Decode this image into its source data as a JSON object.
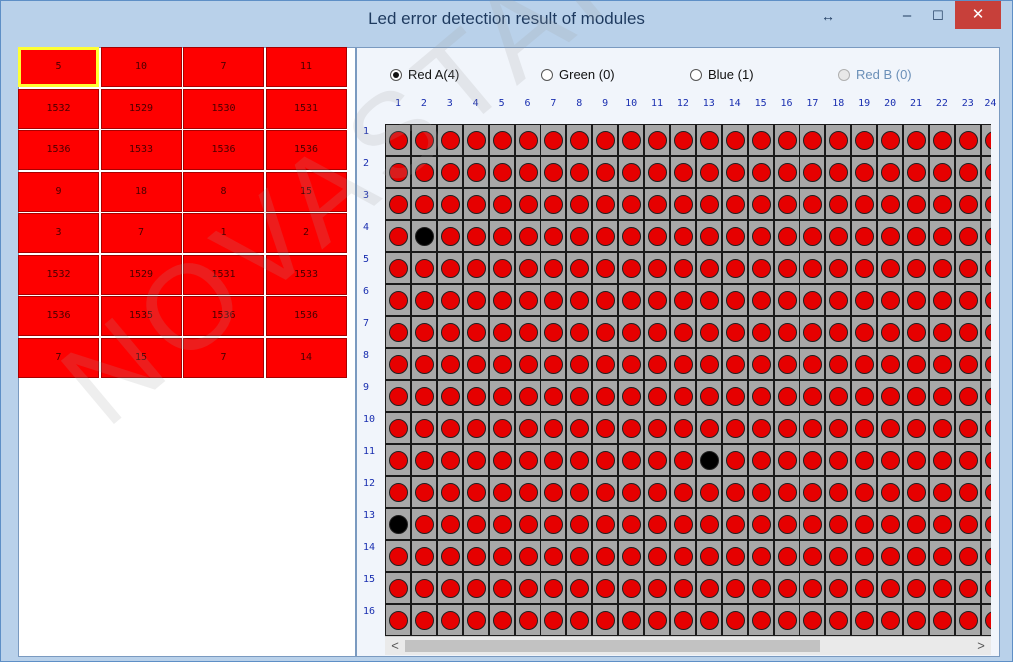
{
  "window": {
    "title": "Led error detection result of modules",
    "controls": {
      "resize": "↔",
      "minimize": "–",
      "maximize": "☐",
      "close": "✕"
    }
  },
  "modules": {
    "selected_index": 0,
    "cells": [
      "5",
      "10",
      "7",
      "11",
      "1532",
      "1529",
      "1530",
      "1531",
      "1536",
      "1533",
      "1536",
      "1536",
      "9",
      "18",
      "8",
      "15",
      "3",
      "7",
      "1",
      "2",
      "1532",
      "1529",
      "1531",
      "1533",
      "1536",
      "1535",
      "1536",
      "1536",
      "7",
      "15",
      "7",
      "14"
    ]
  },
  "color_options": [
    {
      "label": "Red A(4)",
      "checked": true,
      "disabled": false
    },
    {
      "label": "Green (0)",
      "checked": false,
      "disabled": false
    },
    {
      "label": "Blue (1)",
      "checked": false,
      "disabled": false
    },
    {
      "label": "Red B (0)",
      "checked": false,
      "disabled": true
    }
  ],
  "led_matrix": {
    "col_labels": [
      "1",
      "2",
      "3",
      "4",
      "5",
      "6",
      "7",
      "8",
      "9",
      "10",
      "11",
      "12",
      "13",
      "14",
      "15",
      "16",
      "17",
      "18",
      "19",
      "20",
      "21",
      "22",
      "23",
      "24"
    ],
    "row_labels": [
      "1",
      "2",
      "3",
      "4",
      "5",
      "6",
      "7",
      "8",
      "9",
      "10",
      "11",
      "12",
      "13",
      "14",
      "15",
      "16"
    ],
    "error_leds": [
      {
        "row": 4,
        "col": 2
      },
      {
        "row": 11,
        "col": 13
      },
      {
        "row": 13,
        "col": 1
      }
    ],
    "ok_color": "#e60000",
    "error_color": "#000000"
  },
  "scrollbar": {
    "left_arrow": "<",
    "right_arrow": ">"
  },
  "watermark": "NOVASTAR TECH"
}
